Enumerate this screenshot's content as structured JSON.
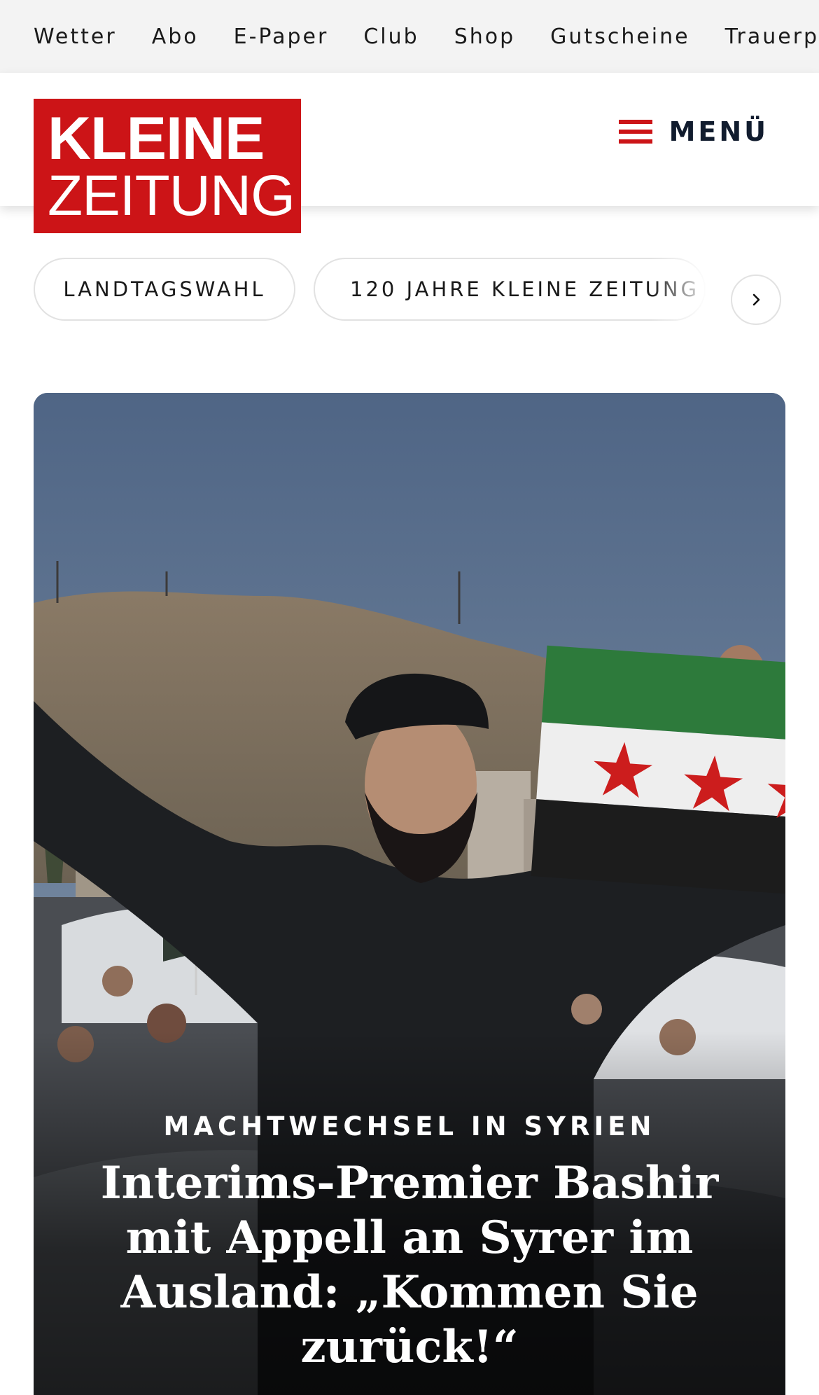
{
  "topnav": {
    "items": [
      "Wetter",
      "Abo",
      "E-Paper",
      "Club",
      "Shop",
      "Gutscheine",
      "Trauerportal"
    ]
  },
  "header": {
    "logo_line1": "KLEINE",
    "logo_line2": "ZEITUNG",
    "menu_label": "MENÜ",
    "brand_color": "#cc1417"
  },
  "topics": {
    "items": [
      "LANDTAGSWAHL",
      "120 JAHRE KLEINE ZEITUNG"
    ],
    "next_icon": "chevron-right-icon"
  },
  "hero": {
    "kicker": "MACHTWECHSEL IN SYRIEN",
    "headline": "Interims-Premier Bashir mit Appell an Syrer im Ausland: „Kommen Sie zurück!“"
  }
}
